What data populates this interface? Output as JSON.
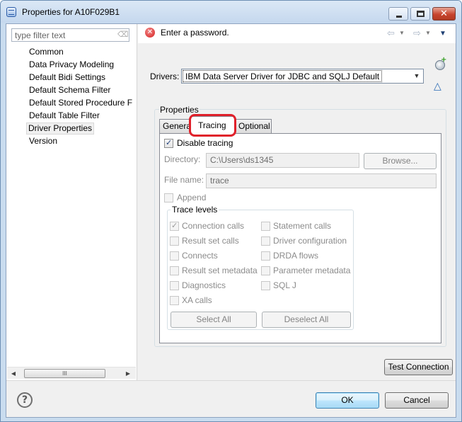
{
  "window": {
    "title": "Properties for A10F029B1"
  },
  "left_pane": {
    "filter_placeholder": "type filter text",
    "items": [
      "Common",
      "Data Privacy Modeling",
      "Default Bidi Settings",
      "Default Schema Filter",
      "Default Stored Procedure F",
      "Default Table Filter",
      "Driver Properties",
      "Version"
    ],
    "selected_index": 6,
    "scrollbar_thumb_glyph": "III"
  },
  "message": {
    "text": "Enter a password.",
    "icon": "error-icon"
  },
  "drivers": {
    "label": "Drivers:",
    "selected": "IBM Data Server Driver for JDBC and SQLJ Default"
  },
  "properties": {
    "label": "Properties",
    "tabs": [
      "General",
      "Tracing",
      "Optional"
    ],
    "active_tab": "Tracing"
  },
  "tracing": {
    "disable_tracing_label": "Disable tracing",
    "disable_tracing_checked": true,
    "directory_label": "Directory:",
    "directory_value": "C:\\Users\\ds1345",
    "browse_label": "Browse...",
    "file_name_label": "File name:",
    "file_name_value": "trace",
    "append_label": "Append",
    "trace_levels_label": "Trace levels",
    "levels_left": [
      {
        "label": "Connection calls",
        "checked": true
      },
      {
        "label": "Result set calls",
        "checked": false
      },
      {
        "label": "Connects",
        "checked": false
      },
      {
        "label": "Result set metadata",
        "checked": false
      },
      {
        "label": "Diagnostics",
        "checked": false
      },
      {
        "label": "XA calls",
        "checked": false
      }
    ],
    "levels_right": [
      {
        "label": "Statement calls",
        "checked": false
      },
      {
        "label": "Driver configuration",
        "checked": false
      },
      {
        "label": "DRDA flows",
        "checked": false
      },
      {
        "label": "Parameter metadata",
        "checked": false
      },
      {
        "label": "SQL J",
        "checked": false
      }
    ],
    "select_all_label": "Select All",
    "deselect_all_label": "Deselect All"
  },
  "buttons": {
    "test_connection": "Test Connection",
    "ok": "OK",
    "cancel": "Cancel"
  },
  "colors": {
    "highlight": "#e0202a",
    "error": "#d51f1f"
  }
}
